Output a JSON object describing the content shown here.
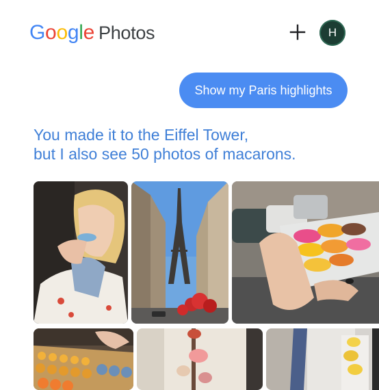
{
  "header": {
    "logo_letters": [
      "G",
      "o",
      "o",
      "g",
      "l",
      "e"
    ],
    "product_name": "Photos",
    "add_icon": "plus-icon",
    "avatar_initial": "H"
  },
  "suggestion": {
    "label": "Show my Paris highlights"
  },
  "assistant_message": {
    "line1": "You made it to the Eiffel Tower,",
    "line2": "but I also see 50 photos of macarons."
  },
  "colors": {
    "google_blue": "#4285F4",
    "google_red": "#EA4335",
    "google_yellow": "#FBBC05",
    "google_green": "#34A853",
    "chip_bg": "#4b8cf2",
    "message_text": "#3f7fd7",
    "avatar_bg": "#1c3d33"
  },
  "photos": [
    {
      "subject": "woman eating macaron"
    },
    {
      "subject": "Eiffel Tower street view"
    },
    {
      "subject": "hand holding box of macarons"
    },
    {
      "subject": "trays of macarons"
    },
    {
      "subject": "macaron tower display"
    },
    {
      "subject": "macarons in window"
    }
  ]
}
